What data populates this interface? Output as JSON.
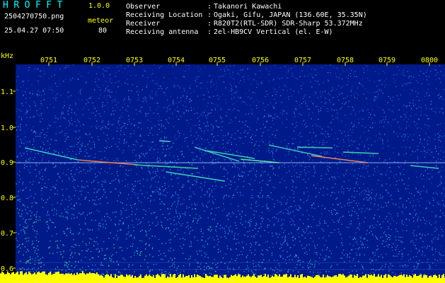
{
  "header": {
    "app_title": "HROFFT",
    "app_version": "1.0.0",
    "file_name": "2504270750.png",
    "mode_label": "meteor",
    "timestamp": "25.04.27 07:50",
    "count_value": "80"
  },
  "info": [
    {
      "key": "Observer",
      "colon": ":",
      "value": "Takanori Kawachi"
    },
    {
      "key": "Receiving Location",
      "colon": ":",
      "value": "Ogaki, Gifu, JAPAN (136.60E, 35.35N)"
    },
    {
      "key": "Receiver",
      "colon": ":",
      "value": "R820T2(RTL-SDR) SDR-Sharp 53.372MHz"
    },
    {
      "key": "Receiving antenna",
      "colon": ":",
      "value": "2el-HB9CV Vertical (el. E-W)"
    }
  ],
  "axes": {
    "y_unit": "kHz",
    "y_ticks": [
      "1.1",
      "1.0",
      "0.9",
      "0.8",
      "0.7",
      "0.6"
    ],
    "x_ticks": [
      "0751",
      "0752",
      "0753",
      "0754",
      "0755",
      "0756",
      "0757",
      "0758",
      "0759",
      "0800"
    ]
  },
  "colors": {
    "background": "#000000",
    "text_cyan": "#00ffff",
    "text_yellow": "#ffff00",
    "text_white": "#ffffff",
    "noise_blue": "#1a3fbf",
    "tone_line": "#cfe8ff"
  }
}
